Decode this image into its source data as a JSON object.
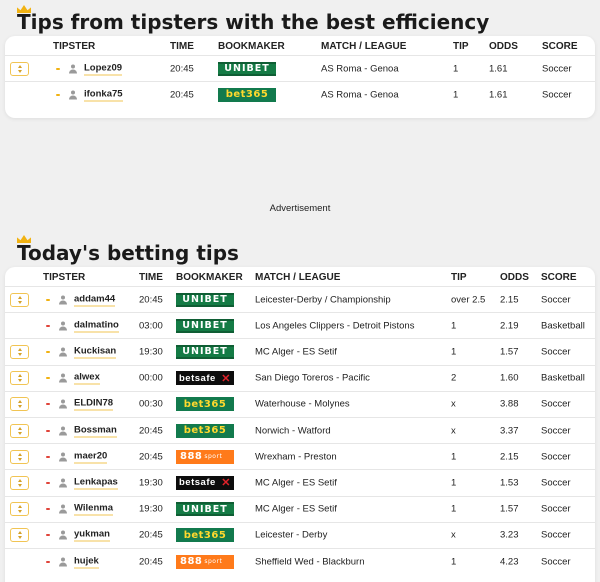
{
  "best_efficiency": {
    "title": "Tips from tipsters with the best efficiency",
    "headers": {
      "tipster": "TIPSTER",
      "time": "TIME",
      "bookmaker": "BOOKMAKER",
      "match": "MATCH / LEAGUE",
      "tip": "TIP",
      "odds": "ODDS",
      "score": "SCORE"
    },
    "rows": [
      {
        "tipster": "Lopez09",
        "time": "20:45",
        "bookmaker": "UNIBET",
        "match": "AS Roma - Genoa",
        "tip": "1",
        "odds": "1.61",
        "score": "Soccer",
        "trend": "up",
        "has_vote": true
      },
      {
        "tipster": "ifonka75",
        "time": "20:45",
        "bookmaker": "bet365",
        "match": "AS Roma - Genoa",
        "tip": "1",
        "odds": "1.61",
        "score": "Soccer",
        "trend": "up",
        "has_vote": false
      }
    ]
  },
  "advertisement_label": "Advertisement",
  "todays_tips": {
    "title": "Today's betting tips",
    "headers": {
      "tipster": "TIPSTER",
      "time": "TIME",
      "bookmaker": "BOOKMAKER",
      "match": "MATCH / LEAGUE",
      "tip": "TIP",
      "odds": "ODDS",
      "score": "SCORE"
    },
    "rows": [
      {
        "tipster": "addam44",
        "time": "20:45",
        "bookmaker": "UNIBET",
        "match": "Leicester-Derby / Championship",
        "tip": "over 2.5",
        "odds": "2.15",
        "score": "Soccer",
        "trend": "up",
        "has_vote": true
      },
      {
        "tipster": "dalmatino",
        "time": "03:00",
        "bookmaker": "UNIBET",
        "match": "Los Angeles Clippers - Detroit Pistons",
        "tip": "1",
        "odds": "2.19",
        "score": "Basketball",
        "trend": "down",
        "has_vote": false
      },
      {
        "tipster": "Kuckisan",
        "time": "19:30",
        "bookmaker": "UNIBET",
        "match": "MC Alger - ES Setif",
        "tip": "1",
        "odds": "1.57",
        "score": "Soccer",
        "trend": "up",
        "has_vote": true
      },
      {
        "tipster": "alwex",
        "time": "00:00",
        "bookmaker": "betsafe",
        "match": "San Diego Toreros - Pacific",
        "tip": "2",
        "odds": "1.60",
        "score": "Basketball",
        "trend": "up",
        "has_vote": true
      },
      {
        "tipster": "ELDIN78",
        "time": "00:30",
        "bookmaker": "bet365",
        "match": "Waterhouse - Molynes",
        "tip": "x",
        "odds": "3.88",
        "score": "Soccer",
        "trend": "down",
        "has_vote": true
      },
      {
        "tipster": "Bossman",
        "time": "20:45",
        "bookmaker": "bet365",
        "match": "Norwich - Watford",
        "tip": "x",
        "odds": "3.37",
        "score": "Soccer",
        "trend": "down",
        "has_vote": true
      },
      {
        "tipster": "maer20",
        "time": "20:45",
        "bookmaker": "888sport",
        "match": "Wrexham - Preston",
        "tip": "1",
        "odds": "2.15",
        "score": "Soccer",
        "trend": "down",
        "has_vote": true
      },
      {
        "tipster": "Lenkapas",
        "time": "19:30",
        "bookmaker": "betsafe",
        "match": "MC Alger - ES Setif",
        "tip": "1",
        "odds": "1.53",
        "score": "Soccer",
        "trend": "down",
        "has_vote": true
      },
      {
        "tipster": "Wilenma",
        "time": "19:30",
        "bookmaker": "UNIBET",
        "match": "MC Alger - ES Setif",
        "tip": "1",
        "odds": "1.57",
        "score": "Soccer",
        "trend": "down",
        "has_vote": true
      },
      {
        "tipster": "yukman",
        "time": "20:45",
        "bookmaker": "bet365",
        "match": "Leicester - Derby",
        "tip": "x",
        "odds": "3.23",
        "score": "Soccer",
        "trend": "down",
        "has_vote": true
      },
      {
        "tipster": "hujek",
        "time": "20:45",
        "bookmaker": "888sport",
        "match": "Sheffield Wed - Blackburn",
        "tip": "1",
        "odds": "4.23",
        "score": "Soccer",
        "trend": "down",
        "has_vote": false
      }
    ]
  },
  "colors": {
    "accent": "#f1b212",
    "trend_down": "#e0443a",
    "unibet": "#147b45",
    "bet365": "#127a4d",
    "888sport": "#ff7a1a",
    "betsafe": "#0d0d0d"
  }
}
